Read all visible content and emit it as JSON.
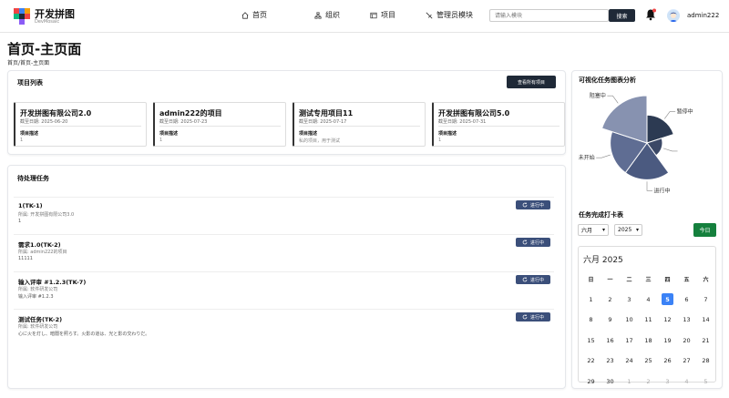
{
  "header": {
    "brand_title": "开发拼图",
    "brand_subtitle": "DevMosaic",
    "nav": [
      {
        "label": "首页",
        "icon": "home-icon"
      },
      {
        "label": "组织",
        "icon": "org-icon"
      },
      {
        "label": "项目",
        "icon": "project-icon"
      },
      {
        "label": "管理员模块",
        "icon": "admin-icon"
      }
    ],
    "search_placeholder": "请输入模块",
    "search_button": "搜索",
    "username": "admin222"
  },
  "page": {
    "title": "首页-主页面",
    "breadcrumb": "首页/首页-主页面"
  },
  "projects": {
    "title": "项目列表",
    "view_all": "查看所有项目",
    "items": [
      {
        "name": "开发拼图有限公司2.0",
        "date": "截至日期: 2025-06-20",
        "desc_label": "项目描述",
        "desc": "1"
      },
      {
        "name": "admin222的项目",
        "date": "截至日期: 2025-07-23",
        "desc_label": "项目描述",
        "desc": "1"
      },
      {
        "name": "测试专用项目11",
        "date": "截至日期: 2025-07-17",
        "desc_label": "项目描述",
        "desc": "私的项目，用于测试"
      },
      {
        "name": "开发拼图有限公司5.0",
        "date": "截至日期: 2025-07-31",
        "desc_label": "项目描述",
        "desc": "1"
      }
    ]
  },
  "tasks": {
    "title": "待处理任务",
    "items": [
      {
        "title": "1(TK-1)",
        "owner": "所属: 开发拼图有限公司3.0",
        "desc": "1",
        "status": "进行中"
      },
      {
        "title": "需求1.0(TK-2)",
        "owner": "所属: admin222的项目",
        "desc": "11111",
        "status": "进行中"
      },
      {
        "title": "输入评审 #1.2.3(TK-7)",
        "owner": "所属: 软件研发公司",
        "desc": "输入评审 #1.2.3",
        "status": "进行中"
      },
      {
        "title": "测试任务(TK-2)",
        "owner": "所属: 软件研发公司",
        "desc": "心に火を灯し、暗闇を照らす。火影の道は、光と影の交わりだ。",
        "status": "进行中"
      }
    ]
  },
  "chart_section": {
    "title": "可视化任务图表分析"
  },
  "chart_data": {
    "type": "pie",
    "variant": "rose",
    "categories": [
      "暂停中",
      "",
      "进行中",
      "未开始",
      "阻塞中"
    ],
    "values": [
      29,
      16,
      38,
      38,
      49
    ],
    "colors": [
      "#2c3a52",
      "#3b4866",
      "#4b5a80",
      "#5f6d93",
      "#8792b0"
    ]
  },
  "checkin": {
    "title": "任务完成打卡表",
    "month_select": "六月",
    "year_select": "2025",
    "today_button": "今日",
    "calendar_title": "六月 2025",
    "weekdays": [
      "日",
      "一",
      "二",
      "三",
      "四",
      "五",
      "六"
    ],
    "days": [
      "1",
      "2",
      "3",
      "4",
      "5",
      "6",
      "7",
      "8",
      "9",
      "10",
      "11",
      "12",
      "13",
      "14",
      "15",
      "16",
      "17",
      "18",
      "19",
      "20",
      "21",
      "22",
      "23",
      "24",
      "25",
      "26",
      "27",
      "28",
      "29",
      "30",
      "1",
      "2",
      "3",
      "4",
      "5"
    ],
    "today": "5"
  }
}
